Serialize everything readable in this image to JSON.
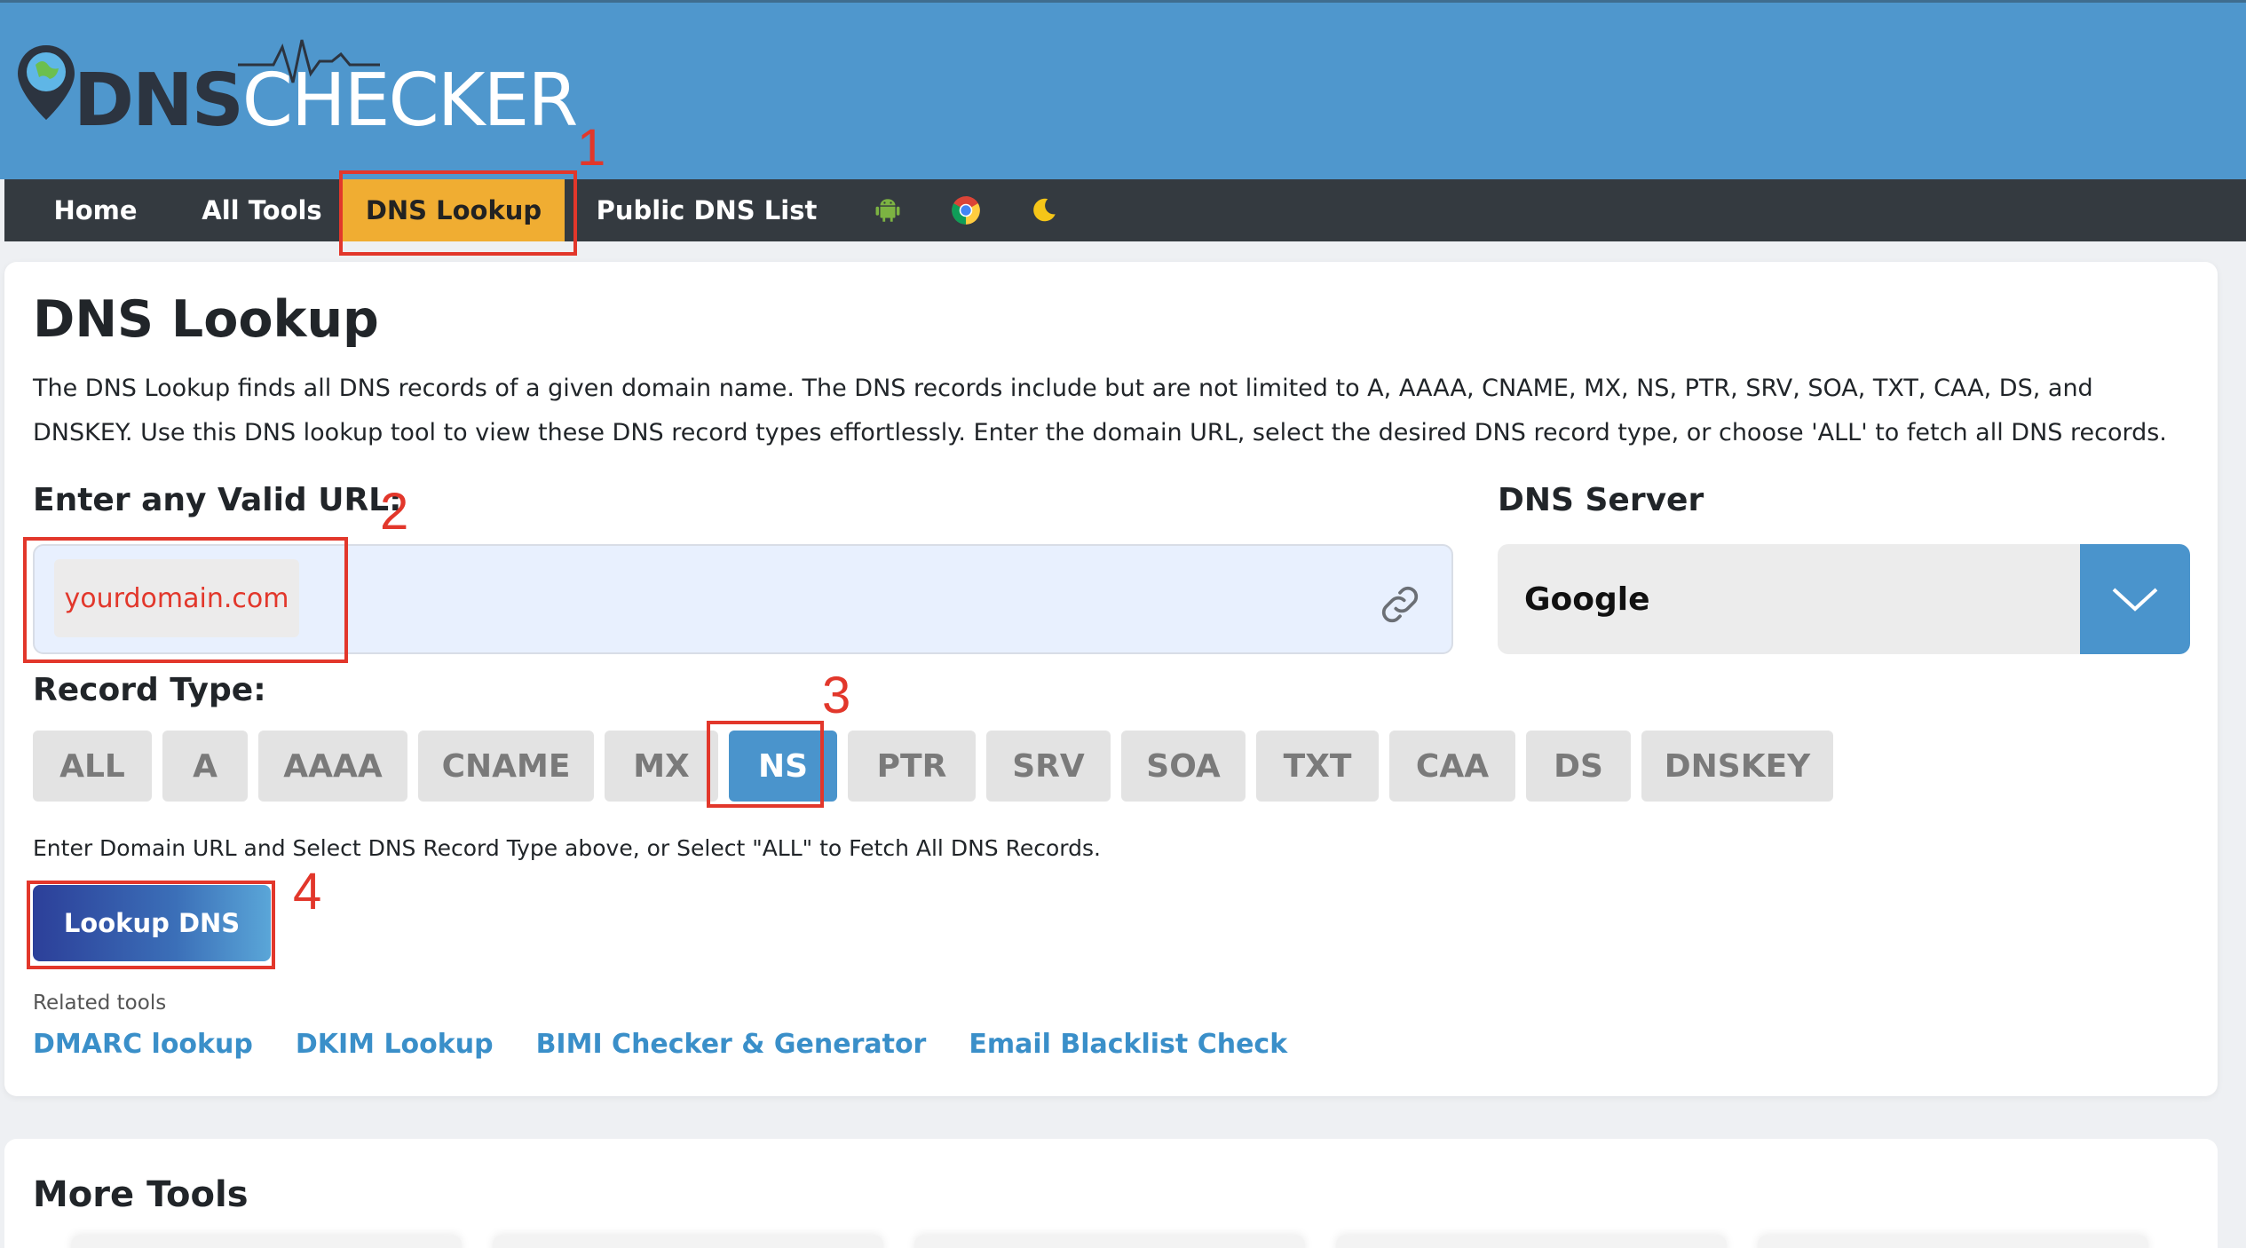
{
  "logo": {
    "dns": "DNS",
    "checker": "CHECKER"
  },
  "nav": {
    "home": "Home",
    "all_tools": "All Tools",
    "dns_lookup": "DNS Lookup",
    "public_dns": "Public DNS List",
    "icons": [
      "android-icon",
      "chrome-icon",
      "moon-icon"
    ]
  },
  "annotations": [
    "1",
    "2",
    "3",
    "4"
  ],
  "card": {
    "title": "DNS Lookup",
    "description": "The DNS Lookup finds all DNS records of a given domain name. The DNS records include but are not limited to A, AAAA, CNAME, MX, NS, PTR, SRV, SOA, TXT, CAA, DS, and DNSKEY. Use this DNS lookup tool to view these DNS record types effortlessly. Enter the domain URL, select the desired DNS record type, or choose 'ALL' to fetch all DNS records.",
    "url_label": "Enter any Valid URL:",
    "url_value": "yourdomain.com",
    "server_label": "DNS Server",
    "server_value": "Google",
    "record_label": "Record Type:",
    "record_types": [
      "ALL",
      "A",
      "AAAA",
      "CNAME",
      "MX",
      "NS",
      "PTR",
      "SRV",
      "SOA",
      "TXT",
      "CAA",
      "DS",
      "DNSKEY"
    ],
    "selected_record": "NS",
    "hint": "Enter Domain URL and Select DNS Record Type above, or Select \"ALL\" to Fetch All DNS Records.",
    "lookup_button": "Lookup DNS",
    "related_label": "Related tools",
    "related_links": [
      "DMARC lookup",
      "DKIM Lookup",
      "BIMI Checker & Generator",
      "Email Blacklist Check"
    ]
  },
  "more_tools": {
    "title": "More Tools"
  },
  "colors": {
    "header": "#4f97cd",
    "navbar": "#343a40",
    "active_tab": "#f0ad32",
    "accent": "#4a94cc",
    "annotation": "#e2372b"
  }
}
